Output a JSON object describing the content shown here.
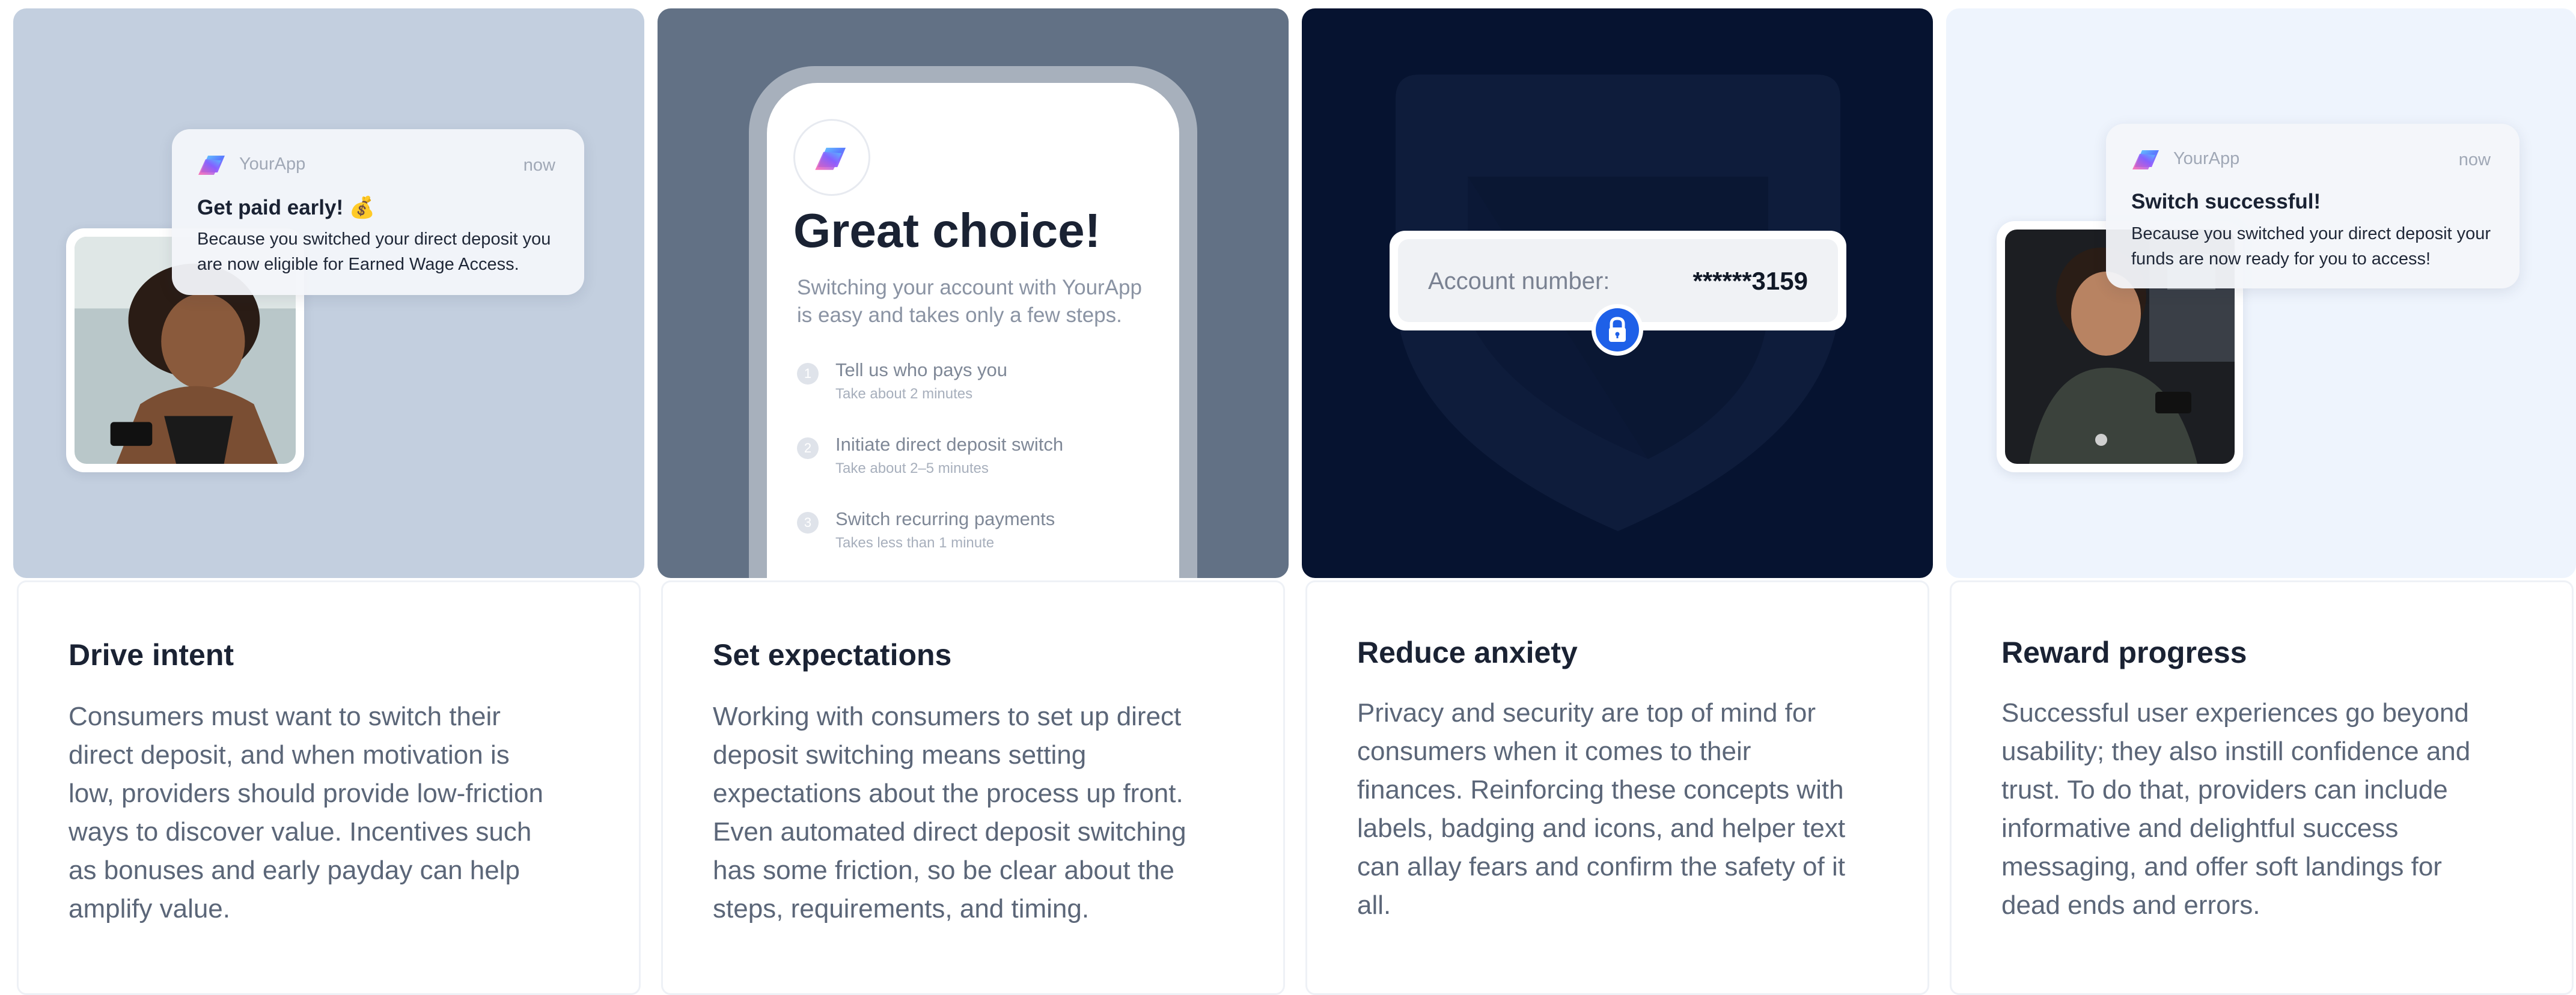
{
  "colors": {
    "card1_bg": "#c3cfdf",
    "card2_bg": "#627185",
    "card3_bg": "#061330",
    "card4_bg": "#eef4fd",
    "accent_blue": "#1e60e8"
  },
  "cards": [
    {
      "title": "Drive intent",
      "body": "Consumers must want to switch their direct deposit, and when motivation is low, providers should provide low-friction ways to discover value. Incentives such as bonuses and early payday can help amplify value.",
      "notification": {
        "app": "YourApp",
        "time": "now",
        "title": "Get paid early! 💰",
        "body": "Because you switched your direct deposit you are now eligible for Earned Wage Access."
      }
    },
    {
      "title": "Set expectations",
      "body": "Working with consumers to set up direct deposit switching means setting expectations about the process up front. Even automated direct deposit switching has some friction, so be clear about the steps, requirements, and timing.",
      "phone": {
        "heading": "Great choice!",
        "subtitle": "Switching your account with YourApp is easy and takes only a few steps.",
        "steps": [
          {
            "num": "1",
            "title": "Tell us who pays you",
            "sub": "Take about 2 minutes"
          },
          {
            "num": "2",
            "title": "Initiate direct deposit switch",
            "sub": "Take about 2–5 minutes"
          },
          {
            "num": "3",
            "title": "Switch recurring payments",
            "sub": "Takes less than 1 minute"
          }
        ]
      }
    },
    {
      "title": "Reduce anxiety",
      "body": "Privacy and security are top of mind for consumers when it comes to their finances. Reinforcing these concepts with labels, badging and icons, and helper text can allay fears and confirm the safety of it all.",
      "account": {
        "label": "Account number:",
        "value": "******3159"
      }
    },
    {
      "title": "Reward progress",
      "body": "Successful user experiences go beyond usability; they also instill confidence and trust. To do that, providers can include informative and delightful success messaging, and offer soft landings for dead ends and errors.",
      "notification": {
        "app": "YourApp",
        "time": "now",
        "title": "Switch successful!",
        "body": "Because you switched your direct deposit your funds are now ready for you to access!"
      }
    }
  ],
  "icons": {
    "app_logo": "app-logo-icon",
    "lock": "lock-icon",
    "shield": "shield-icon"
  }
}
